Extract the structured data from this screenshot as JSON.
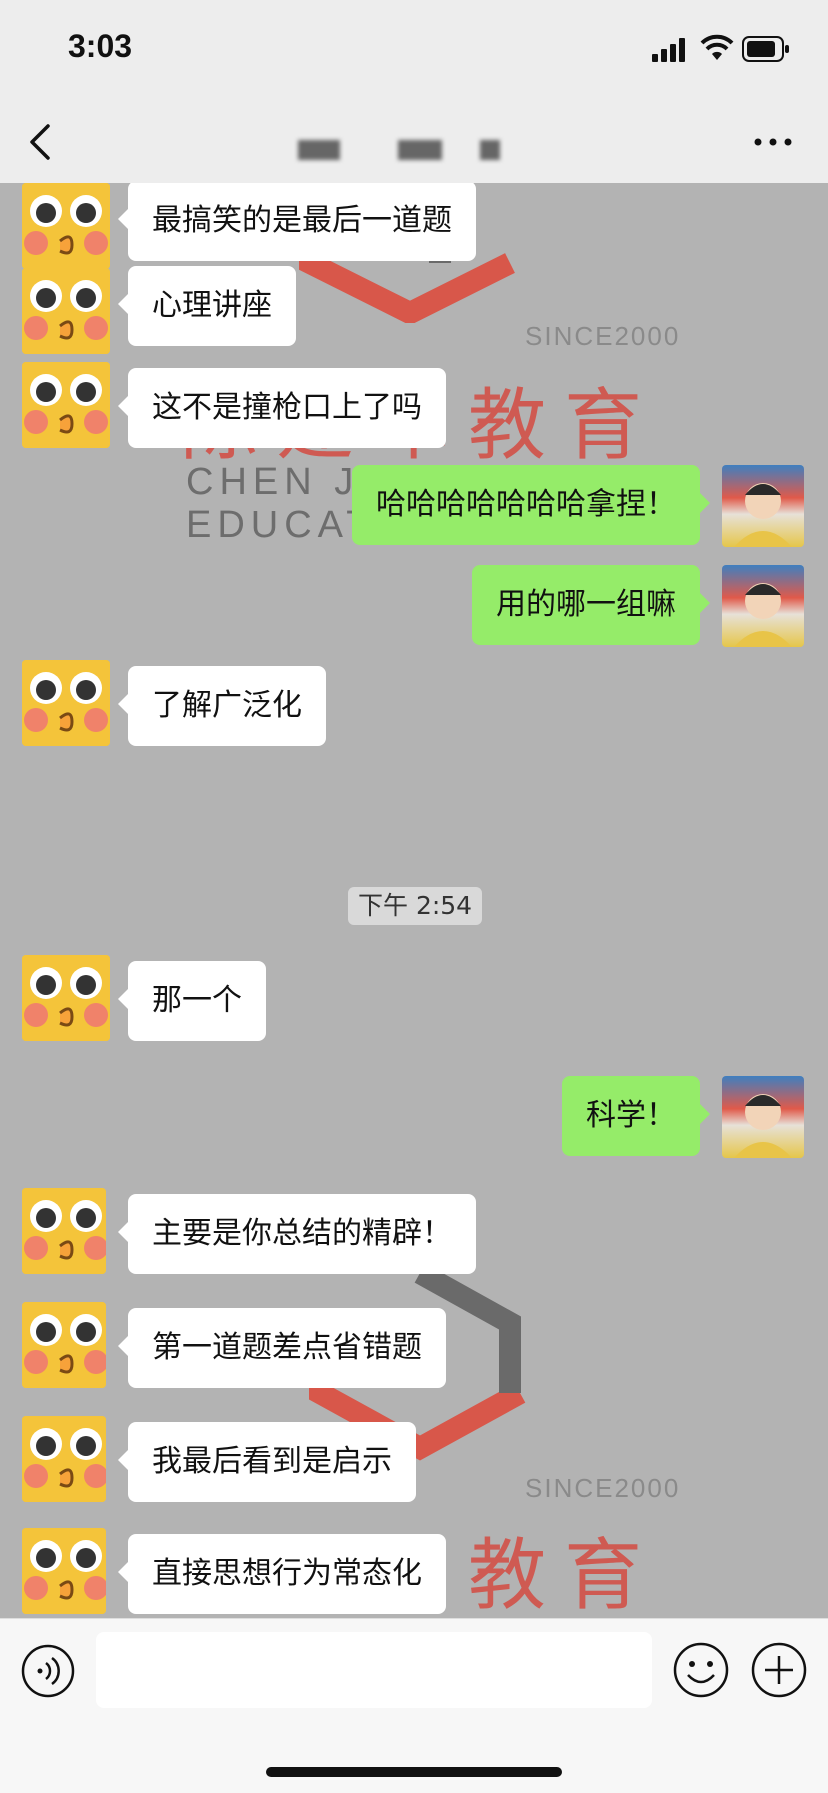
{
  "status_bar": {
    "time": "3:03"
  },
  "header": {
    "title_segments": [
      "",
      "",
      ""
    ]
  },
  "watermark": {
    "since": "SINCE2000",
    "brand": "陈建军教育",
    "english": "CHEN JIAN JUN EDUCATION"
  },
  "messages": [
    {
      "side": "in",
      "text": "最搞笑的是最后一道题"
    },
    {
      "side": "in",
      "text": "心理讲座"
    },
    {
      "side": "in",
      "text": "这不是撞枪口上了吗"
    },
    {
      "side": "out",
      "text": "哈哈哈哈哈哈哈拿捏！"
    },
    {
      "side": "out",
      "text": "用的哪一组嘛"
    },
    {
      "side": "in",
      "text": "了解广泛化"
    },
    {
      "side": "in",
      "text": "那一个"
    },
    {
      "side": "out",
      "text": "科学！"
    },
    {
      "side": "in",
      "text": "主要是你总结的精辟！"
    },
    {
      "side": "in",
      "text": "第一道题差点省错题"
    },
    {
      "side": "in",
      "text": "我最后看到是启示"
    },
    {
      "side": "in",
      "text": "直接思想行为常态化"
    }
  ],
  "timestamp": "下午 2:54",
  "input": {
    "placeholder": ""
  },
  "colors": {
    "incoming_bubble": "#ffffff",
    "outgoing_bubble": "#95ec69",
    "chat_background": "#b3b3b3"
  }
}
